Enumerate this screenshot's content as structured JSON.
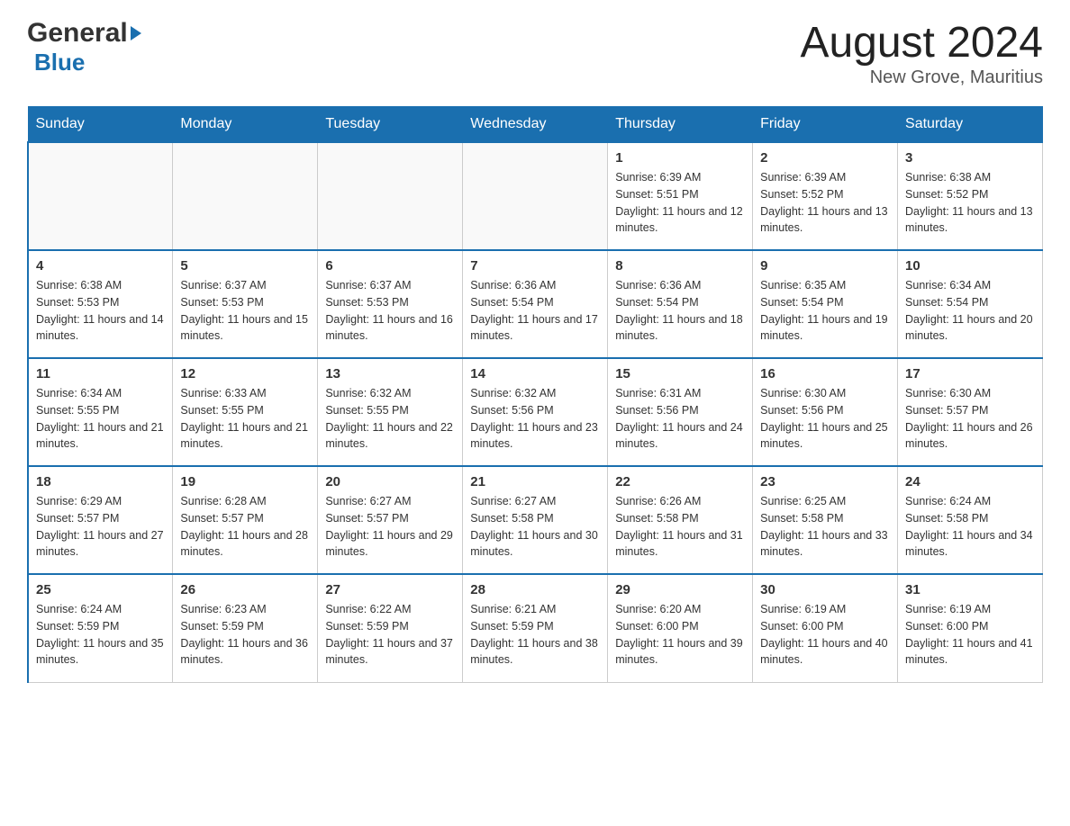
{
  "header": {
    "logo_general": "General",
    "logo_blue": "Blue",
    "title": "August 2024",
    "subtitle": "New Grove, Mauritius"
  },
  "days_of_week": [
    "Sunday",
    "Monday",
    "Tuesday",
    "Wednesday",
    "Thursday",
    "Friday",
    "Saturday"
  ],
  "weeks": [
    [
      {
        "day": "",
        "info": ""
      },
      {
        "day": "",
        "info": ""
      },
      {
        "day": "",
        "info": ""
      },
      {
        "day": "",
        "info": ""
      },
      {
        "day": "1",
        "info": "Sunrise: 6:39 AM\nSunset: 5:51 PM\nDaylight: 11 hours and 12 minutes."
      },
      {
        "day": "2",
        "info": "Sunrise: 6:39 AM\nSunset: 5:52 PM\nDaylight: 11 hours and 13 minutes."
      },
      {
        "day": "3",
        "info": "Sunrise: 6:38 AM\nSunset: 5:52 PM\nDaylight: 11 hours and 13 minutes."
      }
    ],
    [
      {
        "day": "4",
        "info": "Sunrise: 6:38 AM\nSunset: 5:53 PM\nDaylight: 11 hours and 14 minutes."
      },
      {
        "day": "5",
        "info": "Sunrise: 6:37 AM\nSunset: 5:53 PM\nDaylight: 11 hours and 15 minutes."
      },
      {
        "day": "6",
        "info": "Sunrise: 6:37 AM\nSunset: 5:53 PM\nDaylight: 11 hours and 16 minutes."
      },
      {
        "day": "7",
        "info": "Sunrise: 6:36 AM\nSunset: 5:54 PM\nDaylight: 11 hours and 17 minutes."
      },
      {
        "day": "8",
        "info": "Sunrise: 6:36 AM\nSunset: 5:54 PM\nDaylight: 11 hours and 18 minutes."
      },
      {
        "day": "9",
        "info": "Sunrise: 6:35 AM\nSunset: 5:54 PM\nDaylight: 11 hours and 19 minutes."
      },
      {
        "day": "10",
        "info": "Sunrise: 6:34 AM\nSunset: 5:54 PM\nDaylight: 11 hours and 20 minutes."
      }
    ],
    [
      {
        "day": "11",
        "info": "Sunrise: 6:34 AM\nSunset: 5:55 PM\nDaylight: 11 hours and 21 minutes."
      },
      {
        "day": "12",
        "info": "Sunrise: 6:33 AM\nSunset: 5:55 PM\nDaylight: 11 hours and 21 minutes."
      },
      {
        "day": "13",
        "info": "Sunrise: 6:32 AM\nSunset: 5:55 PM\nDaylight: 11 hours and 22 minutes."
      },
      {
        "day": "14",
        "info": "Sunrise: 6:32 AM\nSunset: 5:56 PM\nDaylight: 11 hours and 23 minutes."
      },
      {
        "day": "15",
        "info": "Sunrise: 6:31 AM\nSunset: 5:56 PM\nDaylight: 11 hours and 24 minutes."
      },
      {
        "day": "16",
        "info": "Sunrise: 6:30 AM\nSunset: 5:56 PM\nDaylight: 11 hours and 25 minutes."
      },
      {
        "day": "17",
        "info": "Sunrise: 6:30 AM\nSunset: 5:57 PM\nDaylight: 11 hours and 26 minutes."
      }
    ],
    [
      {
        "day": "18",
        "info": "Sunrise: 6:29 AM\nSunset: 5:57 PM\nDaylight: 11 hours and 27 minutes."
      },
      {
        "day": "19",
        "info": "Sunrise: 6:28 AM\nSunset: 5:57 PM\nDaylight: 11 hours and 28 minutes."
      },
      {
        "day": "20",
        "info": "Sunrise: 6:27 AM\nSunset: 5:57 PM\nDaylight: 11 hours and 29 minutes."
      },
      {
        "day": "21",
        "info": "Sunrise: 6:27 AM\nSunset: 5:58 PM\nDaylight: 11 hours and 30 minutes."
      },
      {
        "day": "22",
        "info": "Sunrise: 6:26 AM\nSunset: 5:58 PM\nDaylight: 11 hours and 31 minutes."
      },
      {
        "day": "23",
        "info": "Sunrise: 6:25 AM\nSunset: 5:58 PM\nDaylight: 11 hours and 33 minutes."
      },
      {
        "day": "24",
        "info": "Sunrise: 6:24 AM\nSunset: 5:58 PM\nDaylight: 11 hours and 34 minutes."
      }
    ],
    [
      {
        "day": "25",
        "info": "Sunrise: 6:24 AM\nSunset: 5:59 PM\nDaylight: 11 hours and 35 minutes."
      },
      {
        "day": "26",
        "info": "Sunrise: 6:23 AM\nSunset: 5:59 PM\nDaylight: 11 hours and 36 minutes."
      },
      {
        "day": "27",
        "info": "Sunrise: 6:22 AM\nSunset: 5:59 PM\nDaylight: 11 hours and 37 minutes."
      },
      {
        "day": "28",
        "info": "Sunrise: 6:21 AM\nSunset: 5:59 PM\nDaylight: 11 hours and 38 minutes."
      },
      {
        "day": "29",
        "info": "Sunrise: 6:20 AM\nSunset: 6:00 PM\nDaylight: 11 hours and 39 minutes."
      },
      {
        "day": "30",
        "info": "Sunrise: 6:19 AM\nSunset: 6:00 PM\nDaylight: 11 hours and 40 minutes."
      },
      {
        "day": "31",
        "info": "Sunrise: 6:19 AM\nSunset: 6:00 PM\nDaylight: 11 hours and 41 minutes."
      }
    ]
  ]
}
